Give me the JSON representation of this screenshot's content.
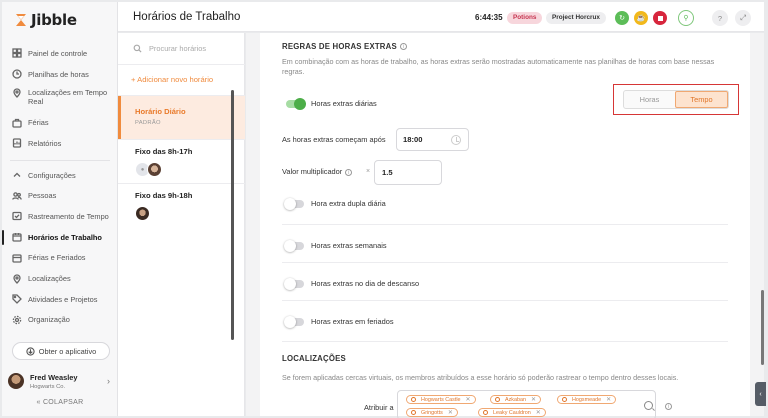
{
  "app": {
    "logo_text": "Jibble",
    "page_title": "Horários de Trabalho",
    "brand_color": "#f08b3e"
  },
  "header": {
    "clock": "6:44:35",
    "activity_badge": "Potions",
    "project_badge": "Project Horcrux",
    "icons": [
      "play-icon",
      "coffee-icon",
      "stop-icon",
      "person-clock-icon",
      "help-icon",
      "stats-icon"
    ]
  },
  "sidebar": {
    "items": [
      {
        "label": "Painel de controle",
        "icon": "dashboard-icon"
      },
      {
        "label": "Planilhas de horas",
        "icon": "clock-icon"
      },
      {
        "label": "Localizações em Tempo Real",
        "icon": "location-pin-icon"
      },
      {
        "label": "Férias",
        "icon": "suitcase-icon"
      },
      {
        "label": "Relatórios",
        "icon": "report-icon"
      }
    ],
    "settings": [
      {
        "label": "Configurações",
        "icon": "chevron-up-icon"
      },
      {
        "label": "Pessoas",
        "icon": "people-icon"
      },
      {
        "label": "Rastreamento de Tempo",
        "icon": "tracking-icon"
      },
      {
        "label": "Horários de Trabalho",
        "icon": "work-schedule-icon",
        "active": true
      },
      {
        "label": "Férias e Feriados",
        "icon": "calendar-icon"
      },
      {
        "label": "Localizações",
        "icon": "map-pin-icon"
      },
      {
        "label": "Atividades e Projetos",
        "icon": "tag-icon"
      },
      {
        "label": "Organização",
        "icon": "gear-icon"
      }
    ],
    "get_app": "Obter o aplicativo",
    "user": {
      "name": "Fred Weasley",
      "org": "Hogwarts Co."
    },
    "collapse": "COLAPSAR"
  },
  "schedules": {
    "search_placeholder": "Procurar horários",
    "add_label": "+ Adicionar novo horário",
    "items": [
      {
        "name": "Horário Diário",
        "tag": "PADRÃO",
        "active": true
      },
      {
        "name": "Fixo das 8h-17h"
      },
      {
        "name": "Fixo das 9h-18h"
      }
    ]
  },
  "overtime": {
    "title": "REGRAS DE HORAS EXTRAS",
    "description": "Em combinação com as horas de trabalho, as horas extras serão mostradas automaticamente nas planilhas de horas com base nessas regras.",
    "daily_label": "Horas extras diárias",
    "daily_on": true,
    "mode_options": [
      "Horas",
      "Tempo"
    ],
    "mode_selected": "Tempo",
    "start_label": "As horas extras começam após",
    "start_value": "18:00",
    "multiplier_label": "Valor multiplicador",
    "multiplier_x": "×",
    "multiplier_value": "1.5",
    "toggles": [
      {
        "label": "Hora extra dupla diária",
        "on": false
      },
      {
        "label": "Horas extras semanais",
        "on": false
      },
      {
        "label": "Horas extras no dia de descanso",
        "on": false
      },
      {
        "label": "Horas extras em feriados",
        "on": false
      }
    ]
  },
  "locations": {
    "title": "LOCALIZAÇÕES",
    "description": "Se forem aplicadas cercas virtuais, os membros atribuídos a esse horário só poderão rastrear o tempo dentro desses locais.",
    "assign_label": "Atribuir a",
    "chips": [
      "Hogwarts Castle",
      "Azkaban",
      "Hogsmeade",
      "Gringotts",
      "Leaky Cauldron"
    ]
  }
}
